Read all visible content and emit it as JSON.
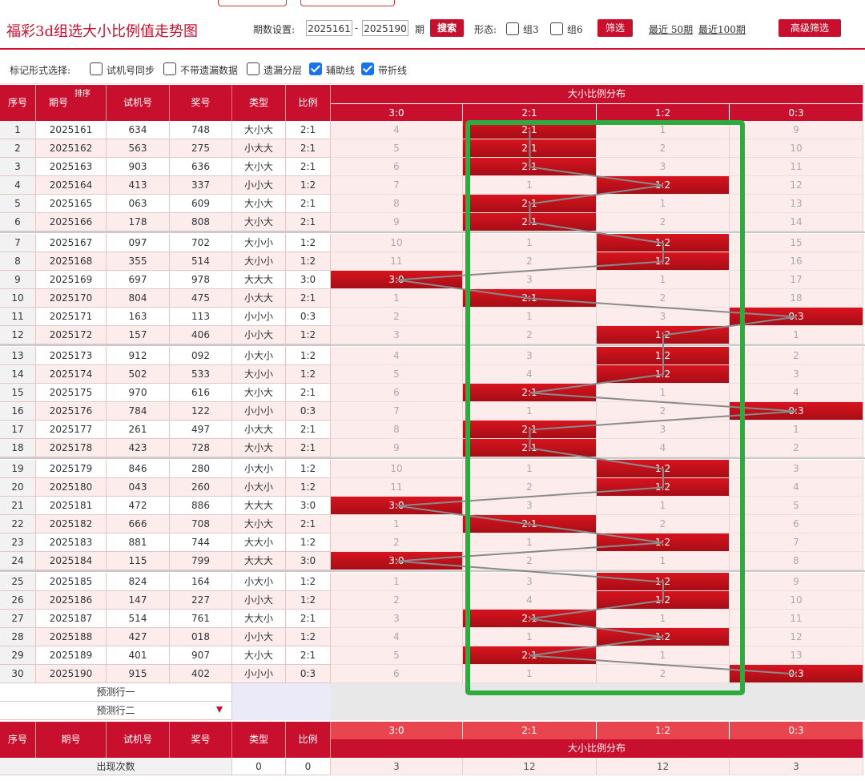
{
  "header": {
    "title": "福彩3d组选大小比例值走势图",
    "period_label": "期数设置:",
    "start_period": "2025161",
    "dash": "-",
    "end_period": "2025190",
    "period_suffix": "期",
    "search_label": "搜索",
    "form_label": "形态:",
    "group3_label": "组3",
    "group6_label": "组6",
    "filter_label": "筛选",
    "recent50": "最近 50期",
    "recent100": "最近100期",
    "advanced_label": "高级筛选"
  },
  "marks": {
    "label": "标记形式选择:",
    "options": [
      {
        "label": "试机号同步",
        "checked": false
      },
      {
        "label": "不带遗漏数据",
        "checked": false
      },
      {
        "label": "遗漏分层",
        "checked": false
      },
      {
        "label": "辅助线",
        "checked": true
      },
      {
        "label": "带折线",
        "checked": true
      }
    ]
  },
  "table": {
    "headers": {
      "seq": "序号",
      "period": "期号",
      "sort": "排序",
      "test": "试机号",
      "prize": "奖号",
      "type": "类型",
      "ratio": "比例",
      "dist": "大小比例分布"
    },
    "dist_cols": [
      "3:0",
      "2:1",
      "1:2",
      "0:3"
    ],
    "rows": [
      {
        "seq": "1",
        "period": "2025161",
        "test": "634",
        "prize": "748",
        "type": "大小大",
        "ratio": "2:1",
        "d": [
          "4",
          "2:1",
          "1",
          "9"
        ]
      },
      {
        "seq": "2",
        "period": "2025162",
        "test": "563",
        "prize": "275",
        "type": "小大大",
        "ratio": "2:1",
        "d": [
          "5",
          "2:1",
          "2",
          "10"
        ]
      },
      {
        "seq": "3",
        "period": "2025163",
        "test": "903",
        "prize": "636",
        "type": "大小大",
        "ratio": "2:1",
        "d": [
          "6",
          "2:1",
          "3",
          "11"
        ]
      },
      {
        "seq": "4",
        "period": "2025164",
        "test": "413",
        "prize": "337",
        "type": "小小大",
        "ratio": "1:2",
        "d": [
          "7",
          "1",
          "1:2",
          "12"
        ]
      },
      {
        "seq": "5",
        "period": "2025165",
        "test": "063",
        "prize": "609",
        "type": "大小大",
        "ratio": "2:1",
        "d": [
          "8",
          "2:1",
          "1",
          "13"
        ]
      },
      {
        "seq": "6",
        "period": "2025166",
        "test": "178",
        "prize": "808",
        "type": "大小大",
        "ratio": "2:1",
        "d": [
          "9",
          "2:1",
          "2",
          "14"
        ]
      },
      {
        "seq": "7",
        "period": "2025167",
        "test": "097",
        "prize": "702",
        "type": "大小小",
        "ratio": "1:2",
        "d": [
          "10",
          "1",
          "1:2",
          "15"
        ]
      },
      {
        "seq": "8",
        "period": "2025168",
        "test": "355",
        "prize": "514",
        "type": "大小小",
        "ratio": "1:2",
        "d": [
          "11",
          "2",
          "1:2",
          "16"
        ]
      },
      {
        "seq": "9",
        "period": "2025169",
        "test": "697",
        "prize": "978",
        "type": "大大大",
        "ratio": "3:0",
        "d": [
          "3:0",
          "3",
          "1",
          "17"
        ]
      },
      {
        "seq": "10",
        "period": "2025170",
        "test": "804",
        "prize": "475",
        "type": "小大大",
        "ratio": "2:1",
        "d": [
          "1",
          "2:1",
          "2",
          "18"
        ]
      },
      {
        "seq": "11",
        "period": "2025171",
        "test": "163",
        "prize": "113",
        "type": "小小小",
        "ratio": "0:3",
        "d": [
          "2",
          "1",
          "3",
          "0:3"
        ]
      },
      {
        "seq": "12",
        "period": "2025172",
        "test": "157",
        "prize": "406",
        "type": "小小大",
        "ratio": "1:2",
        "d": [
          "3",
          "2",
          "1:2",
          "1"
        ]
      },
      {
        "seq": "13",
        "period": "2025173",
        "test": "912",
        "prize": "092",
        "type": "小大小",
        "ratio": "1:2",
        "d": [
          "4",
          "3",
          "1:2",
          "2"
        ]
      },
      {
        "seq": "14",
        "period": "2025174",
        "test": "502",
        "prize": "533",
        "type": "大小小",
        "ratio": "1:2",
        "d": [
          "5",
          "4",
          "1:2",
          "3"
        ]
      },
      {
        "seq": "15",
        "period": "2025175",
        "test": "970",
        "prize": "616",
        "type": "大小大",
        "ratio": "2:1",
        "d": [
          "6",
          "2:1",
          "1",
          "4"
        ]
      },
      {
        "seq": "16",
        "period": "2025176",
        "test": "784",
        "prize": "122",
        "type": "小小小",
        "ratio": "0:3",
        "d": [
          "7",
          "1",
          "2",
          "0:3"
        ]
      },
      {
        "seq": "17",
        "period": "2025177",
        "test": "261",
        "prize": "497",
        "type": "小大大",
        "ratio": "2:1",
        "d": [
          "8",
          "2:1",
          "3",
          "1"
        ]
      },
      {
        "seq": "18",
        "period": "2025178",
        "test": "423",
        "prize": "728",
        "type": "大小大",
        "ratio": "2:1",
        "d": [
          "9",
          "2:1",
          "4",
          "2"
        ]
      },
      {
        "seq": "19",
        "period": "2025179",
        "test": "846",
        "prize": "280",
        "type": "小大小",
        "ratio": "1:2",
        "d": [
          "10",
          "1",
          "1:2",
          "3"
        ]
      },
      {
        "seq": "20",
        "period": "2025180",
        "test": "043",
        "prize": "260",
        "type": "小大小",
        "ratio": "1:2",
        "d": [
          "11",
          "2",
          "1:2",
          "4"
        ]
      },
      {
        "seq": "21",
        "period": "2025181",
        "test": "472",
        "prize": "886",
        "type": "大大大",
        "ratio": "3:0",
        "d": [
          "3:0",
          "3",
          "1",
          "5"
        ]
      },
      {
        "seq": "22",
        "period": "2025182",
        "test": "666",
        "prize": "708",
        "type": "大小大",
        "ratio": "2:1",
        "d": [
          "1",
          "2:1",
          "2",
          "6"
        ]
      },
      {
        "seq": "23",
        "period": "2025183",
        "test": "881",
        "prize": "744",
        "type": "大大小",
        "ratio": "1:2",
        "d": [
          "2",
          "1",
          "1:2",
          "7"
        ]
      },
      {
        "seq": "24",
        "period": "2025184",
        "test": "115",
        "prize": "799",
        "type": "大大大",
        "ratio": "3:0",
        "d": [
          "3:0",
          "2",
          "1",
          "8"
        ]
      },
      {
        "seq": "25",
        "period": "2025185",
        "test": "824",
        "prize": "164",
        "type": "小大小",
        "ratio": "1:2",
        "d": [
          "1",
          "3",
          "1:2",
          "9"
        ]
      },
      {
        "seq": "26",
        "period": "2025186",
        "test": "147",
        "prize": "227",
        "type": "小小大",
        "ratio": "1:2",
        "d": [
          "2",
          "4",
          "1:2",
          "10"
        ]
      },
      {
        "seq": "27",
        "period": "2025187",
        "test": "514",
        "prize": "761",
        "type": "大大小",
        "ratio": "2:1",
        "d": [
          "3",
          "2:1",
          "1",
          "11"
        ]
      },
      {
        "seq": "28",
        "period": "2025188",
        "test": "427",
        "prize": "018",
        "type": "小小大",
        "ratio": "1:2",
        "d": [
          "4",
          "1",
          "1:2",
          "12"
        ]
      },
      {
        "seq": "29",
        "period": "2025189",
        "test": "401",
        "prize": "907",
        "type": "大小大",
        "ratio": "2:1",
        "d": [
          "5",
          "2:1",
          "1",
          "13"
        ]
      },
      {
        "seq": "30",
        "period": "2025190",
        "test": "915",
        "prize": "402",
        "type": "小小小",
        "ratio": "0:3",
        "d": [
          "6",
          "1",
          "2",
          "0:3"
        ]
      }
    ],
    "predict1": "预测行一",
    "predict2": "预测行二",
    "footer_label": "出现次数",
    "footer_vals": [
      "0",
      "0"
    ],
    "footer_dist": [
      "3",
      "12",
      "12",
      "3"
    ]
  },
  "colors": {
    "accent": "#c8102e",
    "highlight_box": "#2eab3e",
    "line": "#8a8a8a"
  }
}
